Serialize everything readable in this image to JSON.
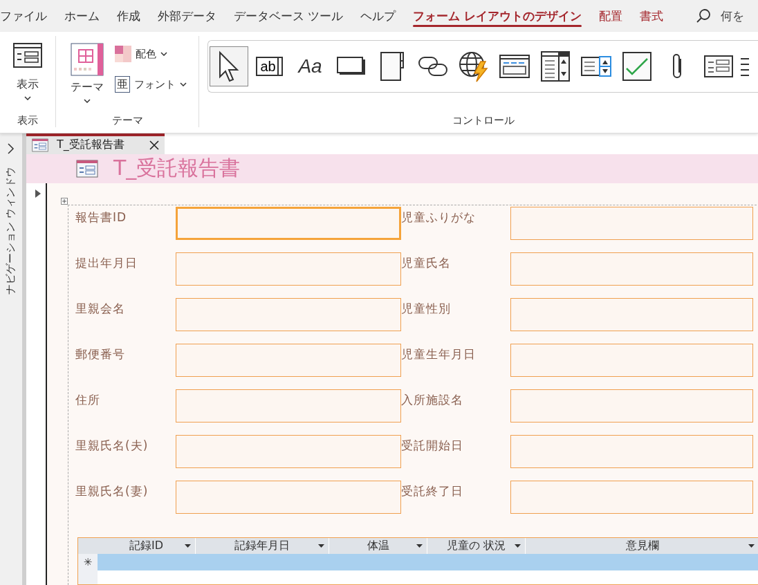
{
  "ribbon_tabs": [
    {
      "label": "ファイル",
      "kind": "normal",
      "selected": false
    },
    {
      "label": "ホーム",
      "kind": "normal",
      "selected": false
    },
    {
      "label": "作成",
      "kind": "normal",
      "selected": false
    },
    {
      "label": "外部データ",
      "kind": "normal",
      "selected": false
    },
    {
      "label": "データベース ツール",
      "kind": "normal",
      "selected": false
    },
    {
      "label": "ヘルプ",
      "kind": "normal",
      "selected": false
    },
    {
      "label": "フォーム レイアウトのデザイン",
      "kind": "contextual",
      "selected": true
    },
    {
      "label": "配置",
      "kind": "contextual",
      "selected": false
    },
    {
      "label": "書式",
      "kind": "contextual",
      "selected": false
    }
  ],
  "tell_me": "何を",
  "groups": {
    "view": {
      "button": "表示",
      "label": "表示"
    },
    "theme": {
      "button": "テーマ",
      "colors": "配色",
      "fonts": "フォント",
      "font_glyph": "亜",
      "label": "テーマ"
    },
    "controls": {
      "label": "コントロール",
      "items": [
        {
          "kind": "pointer",
          "selected": true
        },
        {
          "kind": "textbox",
          "glyph": "ab",
          "selected": false
        },
        {
          "kind": "label",
          "glyph": "Aa",
          "selected": false
        },
        {
          "kind": "button",
          "selected": false
        },
        {
          "kind": "tab",
          "selected": false
        },
        {
          "kind": "link",
          "selected": false
        },
        {
          "kind": "web",
          "selected": false
        },
        {
          "kind": "navigation",
          "selected": false
        },
        {
          "kind": "list",
          "selected": false
        },
        {
          "kind": "combo",
          "selected": false
        },
        {
          "kind": "check",
          "selected": false
        },
        {
          "kind": "attachment",
          "selected": false
        },
        {
          "kind": "form",
          "selected": false
        },
        {
          "kind": "partial",
          "selected": false
        }
      ]
    }
  },
  "nav_pane": {
    "title": "ナビゲーション ウィンドウ"
  },
  "document_tab": {
    "title": "T_受託報告書"
  },
  "form": {
    "title": "T_受託報告書",
    "fields": [
      {
        "label": "報告書ID",
        "focused": true
      },
      {
        "label": "児童ふりがな",
        "focused": false
      },
      {
        "label": "提出年月日",
        "focused": false
      },
      {
        "label": "児童氏名",
        "focused": false
      },
      {
        "label": "里親会名",
        "focused": false
      },
      {
        "label": "児童性別",
        "focused": false
      },
      {
        "label": "郵便番号",
        "focused": false
      },
      {
        "label": "児童生年月日",
        "focused": false
      },
      {
        "label": "住所",
        "focused": false
      },
      {
        "label": "入所施設名",
        "focused": false
      },
      {
        "label": "里親氏名(夫)",
        "focused": false
      },
      {
        "label": "受託開始日",
        "focused": false
      },
      {
        "label": "里親氏名(妻)",
        "focused": false
      },
      {
        "label": "受託終了日",
        "focused": false
      }
    ],
    "subform": {
      "columns": [
        "記録ID",
        "記録年月日",
        "体温",
        "児童の 状況",
        "意見欄"
      ],
      "new_row_marker": "✳"
    }
  }
}
